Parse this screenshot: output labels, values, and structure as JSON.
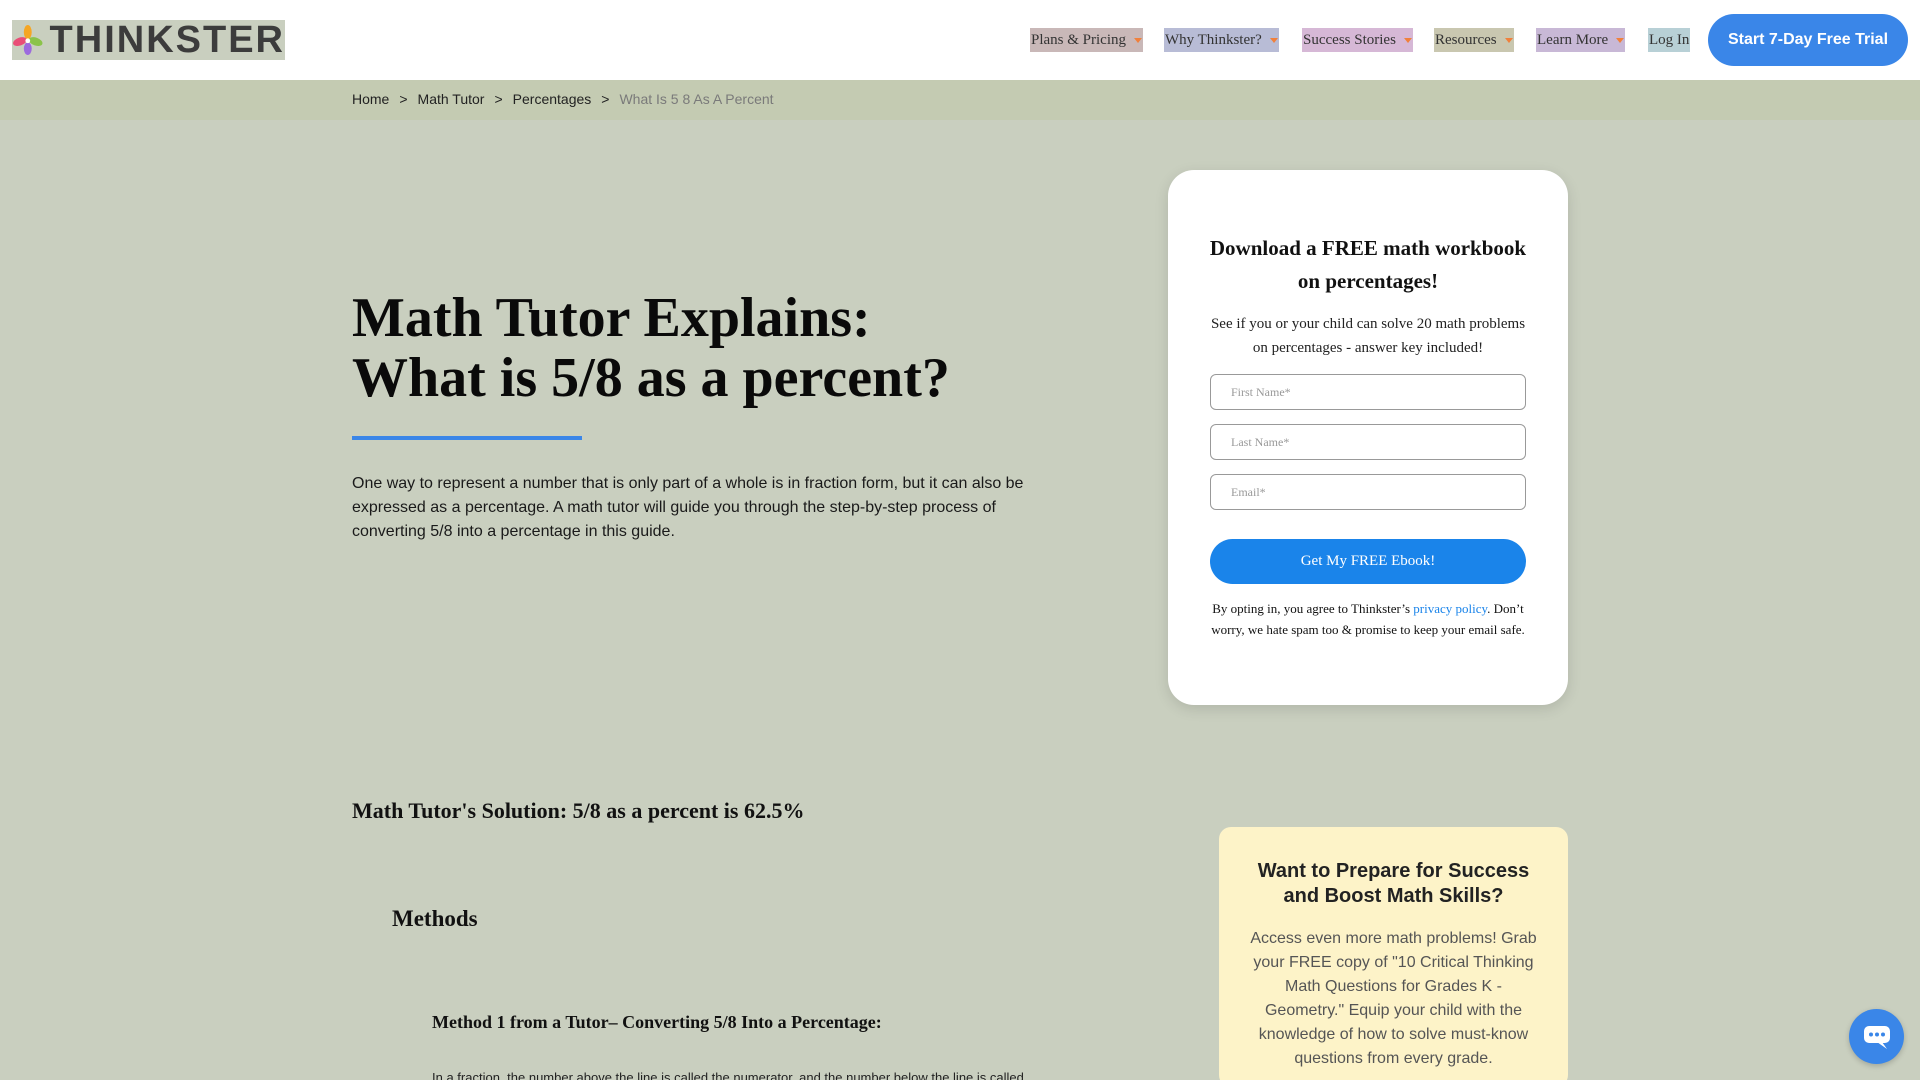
{
  "header": {
    "logo_text": "THINKSTER",
    "nav": [
      {
        "label": "Plans & Pricing",
        "dropdown": true,
        "highlight": "#c9b8b8"
      },
      {
        "label": "Why Thinkster?",
        "dropdown": true,
        "highlight": "#b8bcd6"
      },
      {
        "label": "Success Stories",
        "dropdown": true,
        "highlight": "#d6b8d6"
      },
      {
        "label": "Resources",
        "dropdown": true,
        "highlight": "#c9c7b0"
      },
      {
        "label": "Learn More",
        "dropdown": true,
        "highlight": "#c8b8d6"
      },
      {
        "label": "Log In",
        "dropdown": false,
        "highlight": "#b8d0d6"
      }
    ],
    "cta_label": "Start 7-Day Free Trial"
  },
  "breadcrumb": {
    "items": [
      "Home",
      "Math Tutor",
      "Percentages"
    ],
    "current": "What Is 5 8 As A Percent",
    "separator": ">"
  },
  "hero": {
    "title_line1": "Math Tutor Explains:",
    "title_line2": "What is 5/8 as a percent?",
    "intro": "One way to represent a number that is only part of a whole is in fraction form, but it can also be expressed as a percentage. A math tutor will guide you through the step-by-step process of converting 5/8 into a percentage in this guide."
  },
  "form_card": {
    "title": "Download a FREE math workbook on percentages!",
    "subtitle": "See if you or your child can solve 20 math problems on percentages - answer key included!",
    "fields": [
      {
        "placeholder": "First Name*"
      },
      {
        "placeholder": "Last Name*"
      },
      {
        "placeholder": "Email*"
      }
    ],
    "button_label": "Get My FREE Ebook!",
    "note_before": "By opting in, you agree to Thinkster’s ",
    "note_link": "privacy policy",
    "note_after": ". Don’t worry, we hate spam too & promise to keep your email safe."
  },
  "content": {
    "solution": "Math Tutor's Solution: 5/8 as a percent is 62.5%",
    "methods_heading": "Methods",
    "method1_heading": "Method 1 from a Tutor– Converting 5/8 Into a Percentage:",
    "method1_text": "In a fraction, the number above the line is called the numerator, and the number below the line is called"
  },
  "promo": {
    "title": "Want to Prepare for Success and Boost Math Skills?",
    "text": "Access even more math problems! Grab your FREE copy of \"10 Critical Thinking Math Questions for Grades K - Geometry.\" Equip your child with the knowledge of how to solve must-know questions from every grade."
  },
  "chat": {
    "icon": "chat-bubble-icon"
  },
  "colors": {
    "accent": "#3a86e8",
    "page_bg": "#c9cfbf",
    "promo_bg": "#fdf3c8",
    "caret": "#f0803c"
  }
}
